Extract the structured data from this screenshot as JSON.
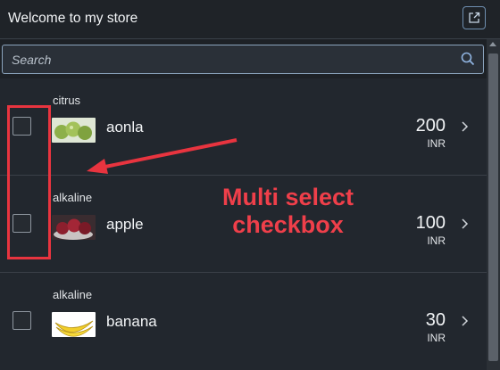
{
  "header": {
    "title": "Welcome to my store",
    "share_icon": "share-icon"
  },
  "search": {
    "placeholder": "Search",
    "icon": "search-icon"
  },
  "items": [
    {
      "category": "citrus",
      "name": "aonla",
      "price": "200",
      "currency": "INR",
      "checked": false
    },
    {
      "category": "alkaline",
      "name": "apple",
      "price": "100",
      "currency": "INR",
      "checked": false
    },
    {
      "category": "alkaline",
      "name": "banana",
      "price": "30",
      "currency": "INR",
      "checked": false
    }
  ],
  "annotation": {
    "line1": "Multi select",
    "line2": "checkbox",
    "color": "#ef3f4a"
  },
  "colors": {
    "background": "#1d2126",
    "row_background": "#22272e",
    "accent_border": "#8ba4bd",
    "highlight": "#e8343f"
  }
}
